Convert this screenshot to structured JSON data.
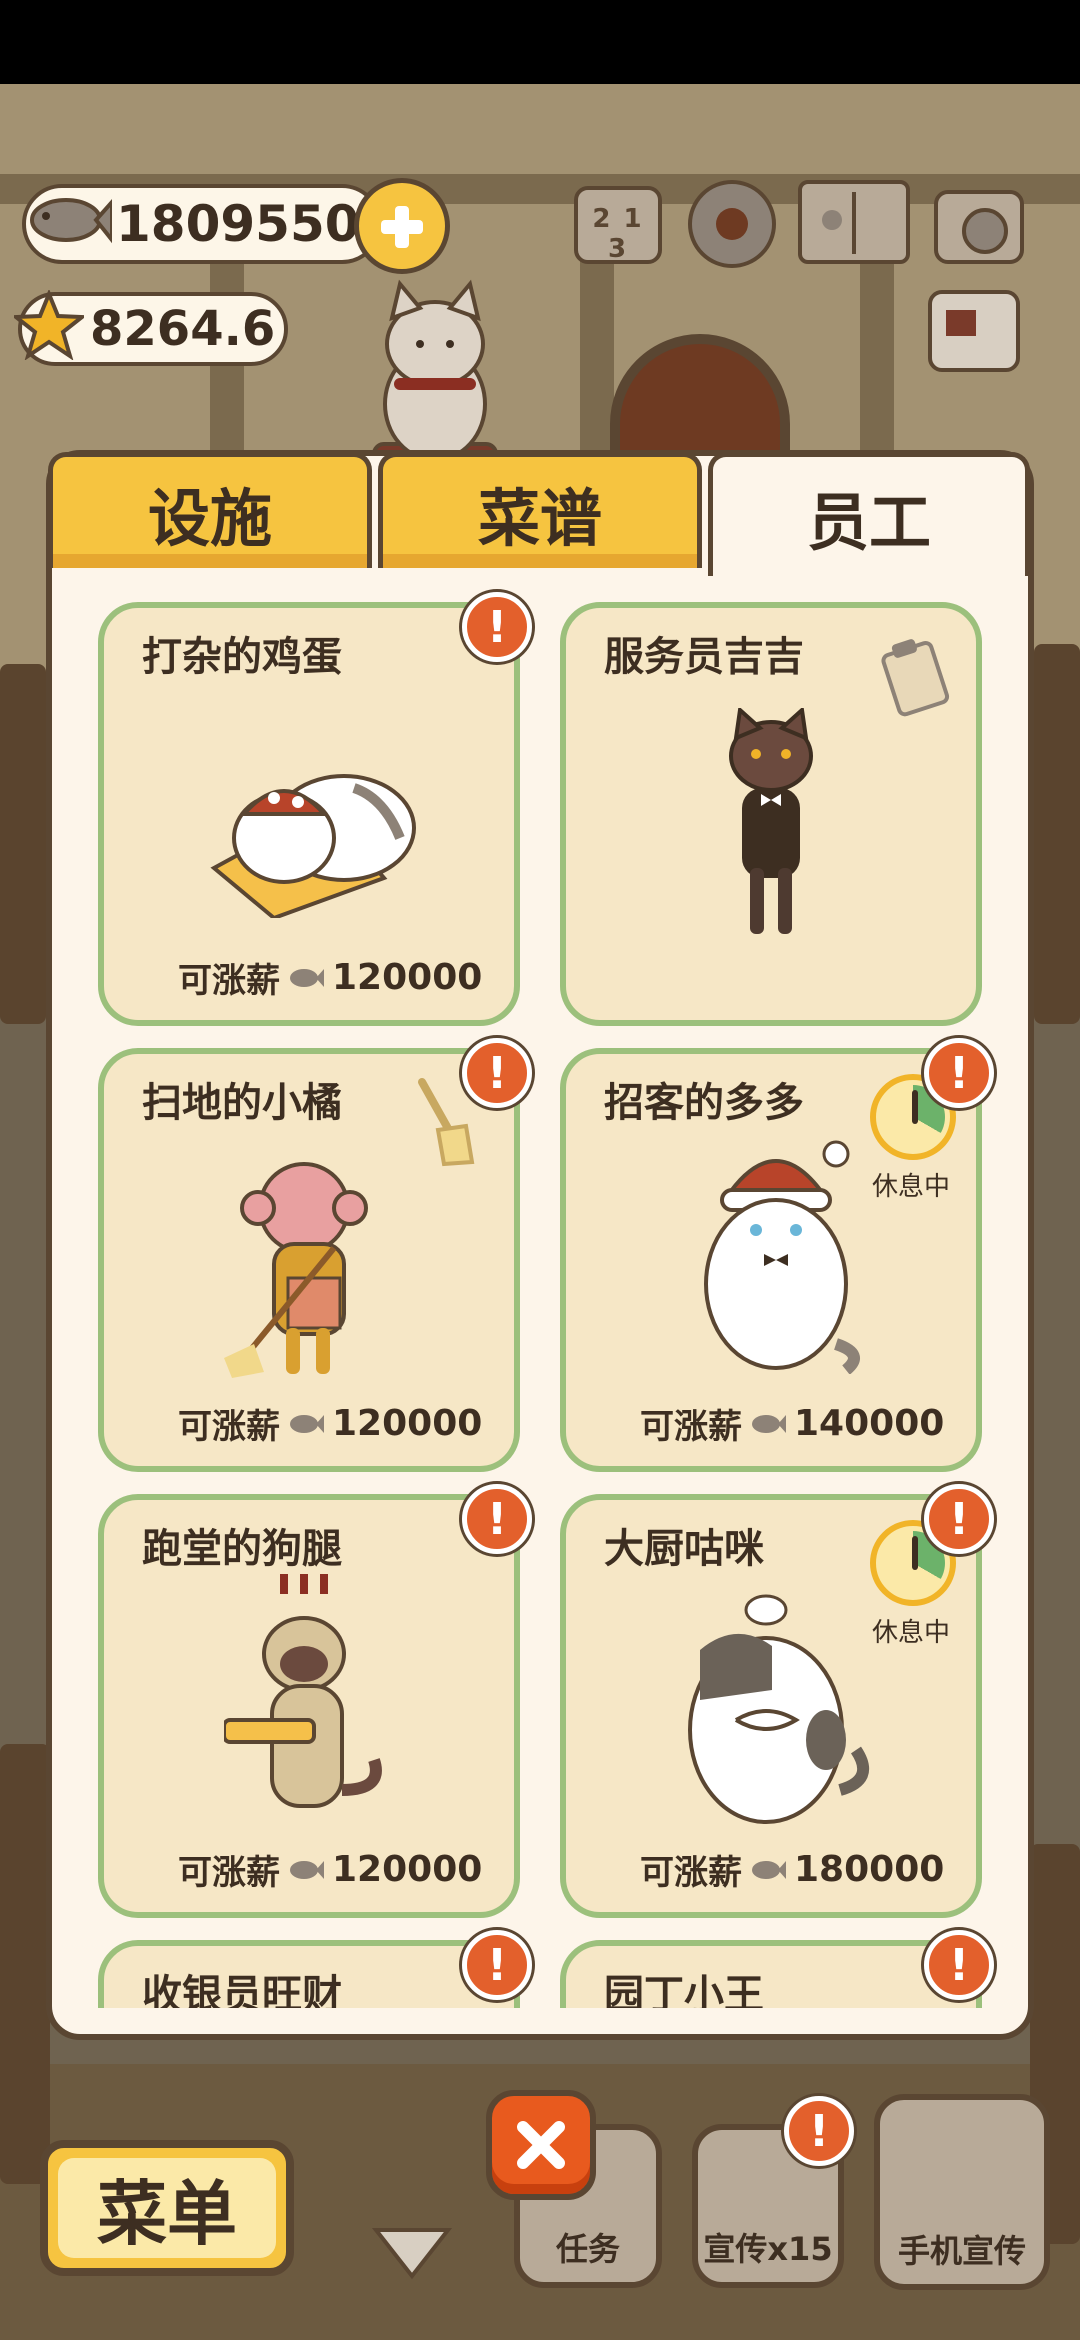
{
  "hud": {
    "fish_count": "1809550",
    "star_count": "8264.6",
    "rank_digits": "2 1 3"
  },
  "tabs": [
    {
      "label": "设施",
      "active": false
    },
    {
      "label": "菜谱",
      "active": false
    },
    {
      "label": "员工",
      "active": true
    }
  ],
  "staff": [
    {
      "name": "打杂的鸡蛋",
      "raise_label": "可涨薪",
      "salary": "120000",
      "alert": "!",
      "resting": false
    },
    {
      "name": "服务员吉吉",
      "raise_label": "",
      "salary": "",
      "alert": "",
      "resting": false
    },
    {
      "name": "扫地的小橘",
      "raise_label": "可涨薪",
      "salary": "120000",
      "alert": "!",
      "resting": false
    },
    {
      "name": "招客的多多",
      "raise_label": "可涨薪",
      "salary": "140000",
      "alert": "!",
      "resting": true,
      "rest_label": "休息中"
    },
    {
      "name": "跑堂的狗腿",
      "raise_label": "可涨薪",
      "salary": "120000",
      "alert": "!",
      "resting": false
    },
    {
      "name": "大厨咕咪",
      "raise_label": "可涨薪",
      "salary": "180000",
      "alert": "!",
      "resting": true,
      "rest_label": "休息中"
    },
    {
      "name": "收银员旺财",
      "raise_label": "",
      "salary": "",
      "alert": "!",
      "resting": false
    },
    {
      "name": "园丁小王",
      "raise_label": "",
      "salary": "",
      "alert": "!",
      "resting": false
    }
  ],
  "bottom": {
    "menu_label": "菜单",
    "task_label": "任务",
    "promo_label": "宣传x15",
    "phone_promo_label": "手机宣传",
    "promo_alert": "!"
  },
  "colors": {
    "accent_yellow": "#f6c440",
    "card_border": "#9cc07c",
    "card_bg": "#f6e7c6",
    "alert_orange": "#e3602c",
    "outline_brown": "#5a4632"
  },
  "icons": [
    "fish-icon",
    "star-icon",
    "plus-icon",
    "leaderboard-icon",
    "gear-icon",
    "book-icon",
    "camera-icon",
    "newspaper-icon",
    "clipboard-icon",
    "broom-icon",
    "timer-icon",
    "close-icon"
  ]
}
